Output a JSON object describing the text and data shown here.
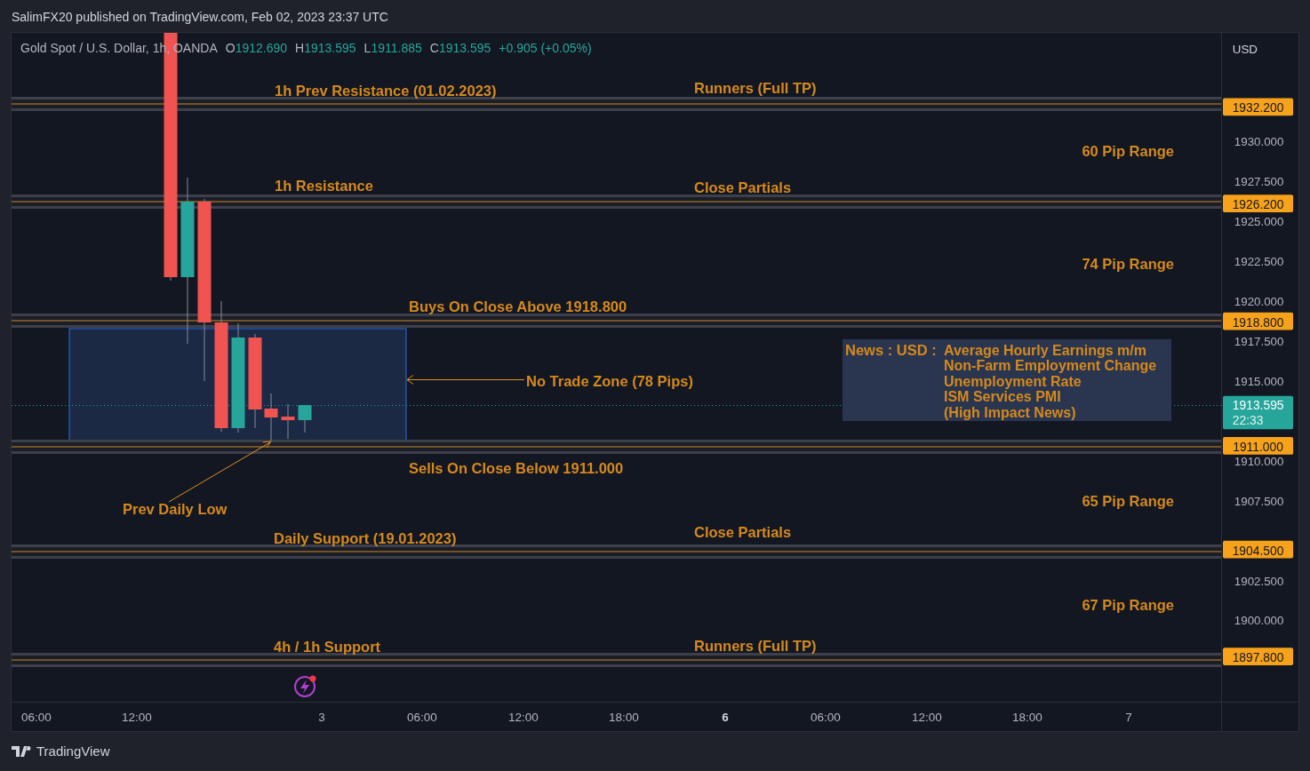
{
  "header": {
    "text": "SalimFX20 published on TradingView.com, Feb 02, 2023 23:37 UTC"
  },
  "legend": {
    "symbol": "Gold Spot / U.S. Dollar,",
    "interval": "1h,",
    "exchange": "OANDA",
    "ohlc": [
      {
        "key": "O",
        "value": "1912.690"
      },
      {
        "key": "H",
        "value": "1913.595"
      },
      {
        "key": "L",
        "value": "1911.885"
      },
      {
        "key": "C",
        "value": "1913.595"
      }
    ],
    "change": "+0.905 (+0.05%)"
  },
  "price_axis": {
    "currency": "USD",
    "ticks": [
      "1930.000",
      "1927.500",
      "1925.000",
      "1922.500",
      "1920.000",
      "1917.500",
      "1915.000",
      "1910.000",
      "1907.500",
      "1902.500",
      "1900.000"
    ]
  },
  "levels": [
    {
      "price": "1932.200",
      "left_label": "1h Prev Resistance (01.02.2023)",
      "right_label": "Runners (Full TP)"
    },
    {
      "price": "1926.200",
      "left_label": "1h Resistance",
      "right_label": "Close Partials"
    },
    {
      "price": "1918.800",
      "left_label": "Buys On Close Above 1918.800"
    },
    {
      "price": "1911.000",
      "left_label": "Sells On Close Below 1911.000"
    },
    {
      "price": "1904.500",
      "left_label": "Daily Support (19.01.2023)",
      "right_label": "Close Partials"
    },
    {
      "price": "1897.800",
      "left_label": "4h / 1h Support",
      "right_label": "Runners (Full TP)"
    }
  ],
  "ranges": [
    "60 Pip Range",
    "74 Pip Range",
    "65 Pip Range",
    "67 Pip Range"
  ],
  "no_trade_zone": {
    "label": "No Trade Zone (78 Pips)"
  },
  "prev_daily_low": {
    "label": "Prev Daily Low"
  },
  "news": {
    "prefix": "News : USD :",
    "items": [
      "Average Hourly Earnings m/m",
      "Non-Farm Employment Change",
      "Unemployment Rate",
      "ISM Services PMI",
      "(High Impact News)"
    ]
  },
  "current_price": {
    "price": "1913.595",
    "countdown": "22:33"
  },
  "time_axis": [
    {
      "label": "06:00",
      "bold": false
    },
    {
      "label": "12:00",
      "bold": false
    },
    {
      "label": "3",
      "bold": false
    },
    {
      "label": "06:00",
      "bold": false
    },
    {
      "label": "12:00",
      "bold": false
    },
    {
      "label": "18:00",
      "bold": false
    },
    {
      "label": "6",
      "bold": true
    },
    {
      "label": "06:00",
      "bold": false
    },
    {
      "label": "12:00",
      "bold": false
    },
    {
      "label": "18:00",
      "bold": false
    },
    {
      "label": "7",
      "bold": false
    }
  ],
  "footer": {
    "brand": "TradingView"
  }
}
